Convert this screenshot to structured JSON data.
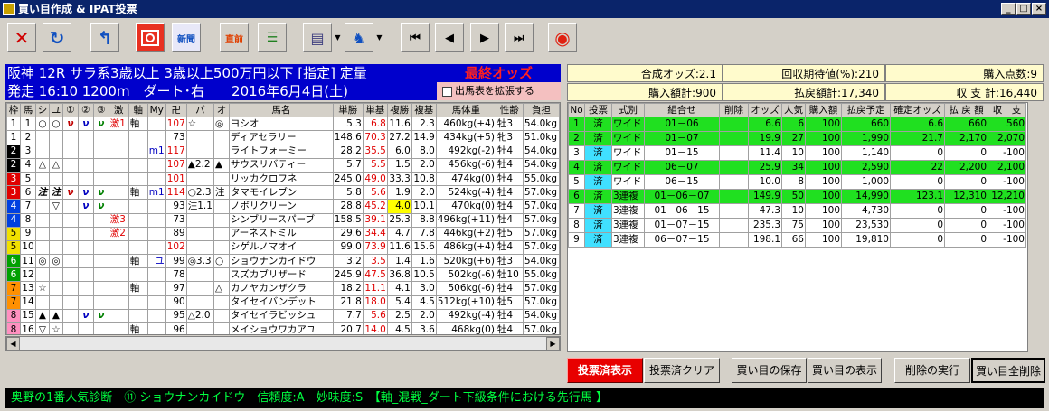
{
  "window": {
    "title": "買い目作成 & IPAT投票",
    "buttons": [
      "_",
      "□",
      "×"
    ]
  },
  "toolbar": {
    "icons": [
      "close-x-icon",
      "undo-icon",
      "return-icon",
      "tv-icon",
      "shinbun-icon",
      "chokuzen-icon",
      "list-icon",
      "document-icon",
      "ipat-horse-icon",
      "first-icon",
      "prev-icon",
      "next-icon",
      "last-icon",
      "red-logo-icon"
    ],
    "shinbun": "新聞",
    "chokuzen": "直前"
  },
  "race": {
    "line1": "阪神 12R サラ系3歳以上 3歳以上500万円以下 [指定] 定量",
    "line2": "発走 16:10 1200m　ダート･右　　2016年6月4日(土)"
  },
  "odds_label": "最終オッズ",
  "expand_label": "出馬表を拡張する",
  "summary": {
    "gousei": "合成オッズ:2.1",
    "kaishu": "回収期待値(%):210",
    "tensu": "購入点数:9",
    "kounyu": "購入額計:900",
    "haraimodoshi": "払戻額計:17,340",
    "shushi": "収 支 計:16,440"
  },
  "left_headers": [
    "枠",
    "馬",
    "シ",
    "ユ",
    "①",
    "②",
    "③",
    "激",
    "軸",
    "My",
    "卍",
    "パ",
    "オ",
    "馬名",
    "単勝",
    "単基",
    "複勝",
    "複基",
    "馬体重",
    "性齢",
    "負担"
  ],
  "horses": [
    [
      "1",
      "1",
      "○",
      "○",
      "ν",
      "ν",
      "ν",
      "激1",
      "軸",
      "",
      "107",
      "☆",
      "◎",
      "ヨシオ",
      "5.3",
      "6.8",
      "11.6",
      "2.3",
      "460kg(+4)",
      "牡3",
      "54.0kg"
    ],
    [
      "1",
      "2",
      "",
      "",
      "",
      "",
      "",
      "",
      "",
      "",
      "73",
      "",
      "",
      "ディアセラリー",
      "148.6",
      "70.3",
      "27.2",
      "14.9",
      "434kg(+5)",
      "牝3",
      "51.0kg"
    ],
    [
      "2",
      "3",
      "",
      "",
      "",
      "",
      "",
      "",
      "",
      "m1",
      "117",
      "",
      "",
      "ライトフォーミー",
      "28.2",
      "35.5",
      "6.0",
      "8.0",
      "492kg(-2)",
      "牡4",
      "54.0kg"
    ],
    [
      "2",
      "4",
      "△",
      "△",
      "",
      "",
      "",
      "",
      "",
      "",
      "107",
      "▲2.2",
      "▲",
      "サウスリバティー",
      "5.7",
      "5.5",
      "1.5",
      "2.0",
      "456kg(-6)",
      "牡4",
      "54.0kg"
    ],
    [
      "3",
      "5",
      "",
      "",
      "",
      "",
      "",
      "",
      "",
      "",
      "101",
      "",
      "",
      "リッカクロフネ",
      "245.0",
      "49.0",
      "33.3",
      "10.8",
      "474kg(0)",
      "牡4",
      "55.0kg"
    ],
    [
      "3",
      "6",
      "注",
      "注",
      "ν",
      "ν",
      "ν",
      "",
      "軸",
      "m1",
      "114",
      "○2.3",
      "注",
      "タマモイレブン",
      "5.8",
      "5.6",
      "1.9",
      "2.0",
      "524kg(-4)",
      "牡4",
      "57.0kg"
    ],
    [
      "4",
      "7",
      "",
      "▽",
      "",
      "ν",
      "ν",
      "",
      "",
      "",
      "93",
      "注1.1",
      "",
      "ノボリクリーン",
      "28.8",
      "45.2",
      "4.0",
      "10.1",
      "470kg(0)",
      "牡4",
      "57.0kg"
    ],
    [
      "4",
      "8",
      "",
      "",
      "",
      "",
      "",
      "激3",
      "",
      "",
      "73",
      "",
      "",
      "シンブリースパーブ",
      "158.5",
      "39.1",
      "25.3",
      "8.8",
      "496kg(+11)",
      "牡4",
      "57.0kg"
    ],
    [
      "5",
      "9",
      "",
      "",
      "",
      "",
      "",
      "激2",
      "",
      "",
      "89",
      "",
      "",
      "アーネストミル",
      "29.6",
      "34.4",
      "4.7",
      "7.8",
      "446kg(+2)",
      "牡5",
      "57.0kg"
    ],
    [
      "5",
      "10",
      "",
      "",
      "",
      "",
      "",
      "",
      "",
      "",
      "102",
      "",
      "",
      "シゲルノマオイ",
      "99.0",
      "73.9",
      "11.6",
      "15.6",
      "486kg(+4)",
      "牡4",
      "57.0kg"
    ],
    [
      "6",
      "11",
      "◎",
      "◎",
      "",
      "",
      "",
      "",
      "軸",
      "ユ",
      "99",
      "◎3.3",
      "○",
      "ショウナンカイドウ",
      "3.2",
      "3.5",
      "1.4",
      "1.6",
      "520kg(+6)",
      "牡3",
      "54.0kg"
    ],
    [
      "6",
      "12",
      "",
      "",
      "",
      "",
      "",
      "",
      "",
      "",
      "78",
      "",
      "",
      "スズカブリザード",
      "245.9",
      "47.5",
      "36.8",
      "10.5",
      "502kg(-6)",
      "牡10",
      "55.0kg"
    ],
    [
      "7",
      "13",
      "☆",
      "",
      "",
      "",
      "",
      "",
      "軸",
      "",
      "97",
      "",
      "△",
      "カノヤカンザクラ",
      "18.2",
      "11.1",
      "4.1",
      "3.0",
      "506kg(-6)",
      "牡4",
      "57.0kg"
    ],
    [
      "7",
      "14",
      "",
      "",
      "",
      "",
      "",
      "",
      "",
      "",
      "90",
      "",
      "",
      "タイセイバンデット",
      "21.8",
      "18.0",
      "5.4",
      "4.5",
      "512kg(+10)",
      "牡5",
      "57.0kg"
    ],
    [
      "8",
      "15",
      "▲",
      "▲",
      "",
      "ν",
      "ν",
      "",
      "",
      "",
      "95",
      "△2.0",
      "",
      "タイセイラビッシュ",
      "7.7",
      "5.6",
      "2.5",
      "2.0",
      "492kg(-4)",
      "牡4",
      "54.0kg"
    ],
    [
      "8",
      "16",
      "▽",
      "☆",
      "",
      "",
      "",
      "",
      "軸",
      "",
      "96",
      "",
      "",
      "メイショウワカアユ",
      "20.7",
      "14.0",
      "4.5",
      "3.6",
      "468kg(0)",
      "牡4",
      "57.0kg"
    ]
  ],
  "right_headers": [
    "No",
    "投票",
    "式別",
    "組合せ",
    "削除",
    "オッズ",
    "人気",
    "購入額",
    "払戻予定",
    "確定オッズ",
    "払 戻 額",
    "収　支"
  ],
  "bets": [
    [
      "1",
      "済",
      "ワイド",
      "01－06",
      "",
      "6.6",
      "6",
      "100",
      "660",
      "6.6",
      "660",
      "560"
    ],
    [
      "2",
      "済",
      "ワイド",
      "01－07",
      "",
      "19.9",
      "27",
      "100",
      "1,990",
      "21.7",
      "2,170",
      "2,070"
    ],
    [
      "3",
      "済",
      "ワイド",
      "01－15",
      "",
      "11.4",
      "10",
      "100",
      "1,140",
      "0",
      "0",
      "-100"
    ],
    [
      "4",
      "済",
      "ワイド",
      "06－07",
      "",
      "25.9",
      "34",
      "100",
      "2,590",
      "22",
      "2,200",
      "2,100"
    ],
    [
      "5",
      "済",
      "ワイド",
      "06－15",
      "",
      "10.0",
      "8",
      "100",
      "1,000",
      "0",
      "0",
      "-100"
    ],
    [
      "6",
      "済",
      "3連複",
      "01－06－07",
      "",
      "149.9",
      "50",
      "100",
      "14,990",
      "123.1",
      "12,310",
      "12,210"
    ],
    [
      "7",
      "済",
      "3連複",
      "01－06－15",
      "",
      "47.3",
      "10",
      "100",
      "4,730",
      "0",
      "0",
      "-100"
    ],
    [
      "8",
      "済",
      "3連複",
      "01－07－15",
      "",
      "235.3",
      "75",
      "100",
      "23,530",
      "0",
      "0",
      "-100"
    ],
    [
      "9",
      "済",
      "3連複",
      "06－07－15",
      "",
      "198.1",
      "66",
      "100",
      "19,810",
      "0",
      "0",
      "-100"
    ]
  ],
  "win_rows": [
    1,
    2,
    4,
    6
  ],
  "buttons": {
    "show_voted": "投票済表示",
    "clear_voted": "投票済クリア",
    "save": "買い目の保存",
    "display": "買い目の表示",
    "delete_exec": "削除の実行",
    "delete_all": "買い目全削除"
  },
  "status": "奥野の1番人気診断　⑪ ショウナンカイドウ　信頼度:A　妙味度:S　【軸_混戦_ダート下級条件における先行馬 】",
  "colors": {
    "title": "#0a246a",
    "race_bg": "#0000cc",
    "odds_text": "#ff2020",
    "win_green": "#20e020",
    "status_text": "#00ff40"
  }
}
